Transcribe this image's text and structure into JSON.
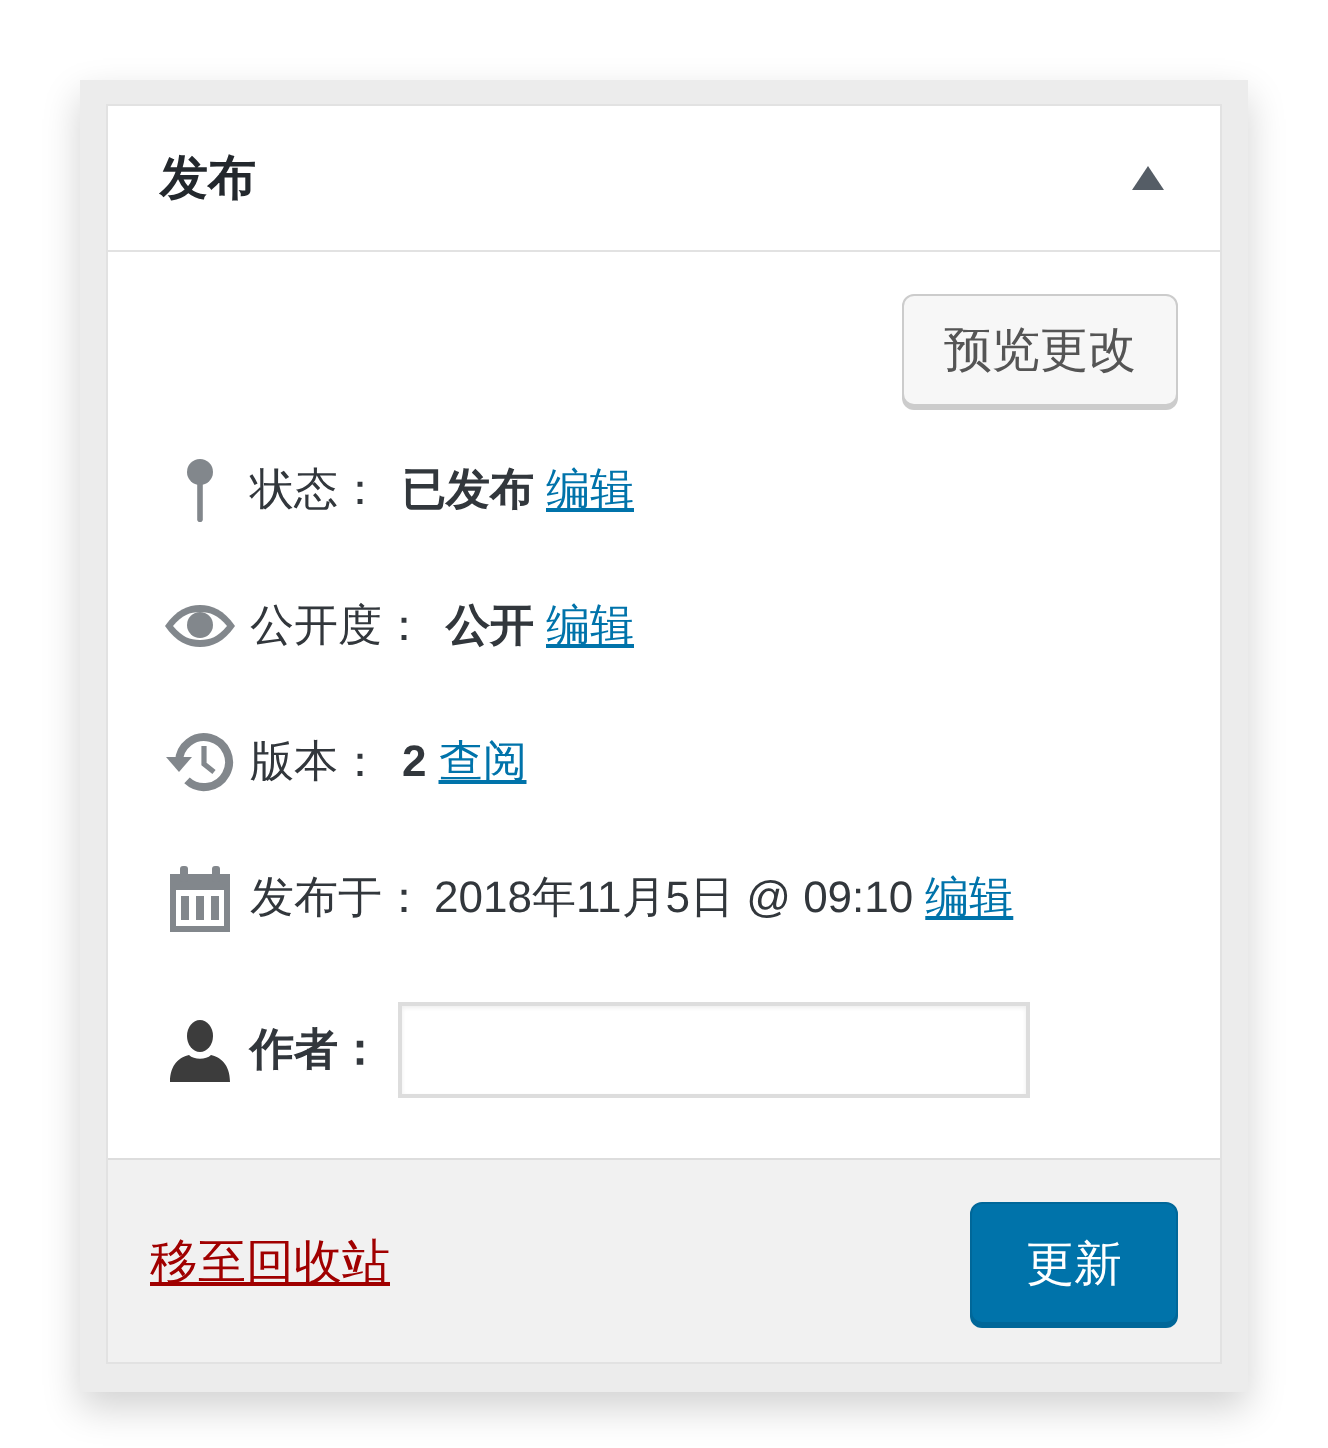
{
  "panel": {
    "title": "发布",
    "expanded": true
  },
  "preview_button": "预览更改",
  "meta": [
    {
      "kind": "status",
      "label": "状态：",
      "value": "已发布",
      "emphasis": true,
      "link": "编辑"
    },
    {
      "kind": "visibility",
      "label": "公开度：",
      "value": "公开",
      "emphasis": true,
      "link": "编辑"
    },
    {
      "kind": "revisions",
      "label": "版本：",
      "value": "2",
      "emphasis": true,
      "link": "查阅"
    },
    {
      "kind": "date",
      "label": "发布于：",
      "value": "2018年11月5日 @ 09:10",
      "emphasis": false,
      "link": "编辑"
    }
  ],
  "author": {
    "label": "作者："
  },
  "footer": {
    "trash_link": "移至回收站",
    "update_button": "更新"
  }
}
